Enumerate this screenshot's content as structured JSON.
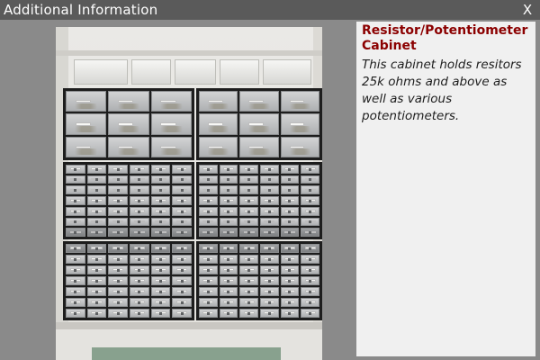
{
  "window": {
    "title": "Additional Information",
    "close_label": "X"
  },
  "panel": {
    "title": "Resistor/Potentiometer Cabinet",
    "description": "This cabinet holds resitors 25k ohms and above as well as various potentiometers."
  },
  "photo": {
    "subject": "storage cabinet with small parts drawers"
  },
  "colors": {
    "titlebar": "#5a5a5a",
    "background": "#8a8a8a",
    "panel_background": "#f0f0f0",
    "panel_title": "#8b0000",
    "cabinet_frame": "#1d1d1d"
  }
}
